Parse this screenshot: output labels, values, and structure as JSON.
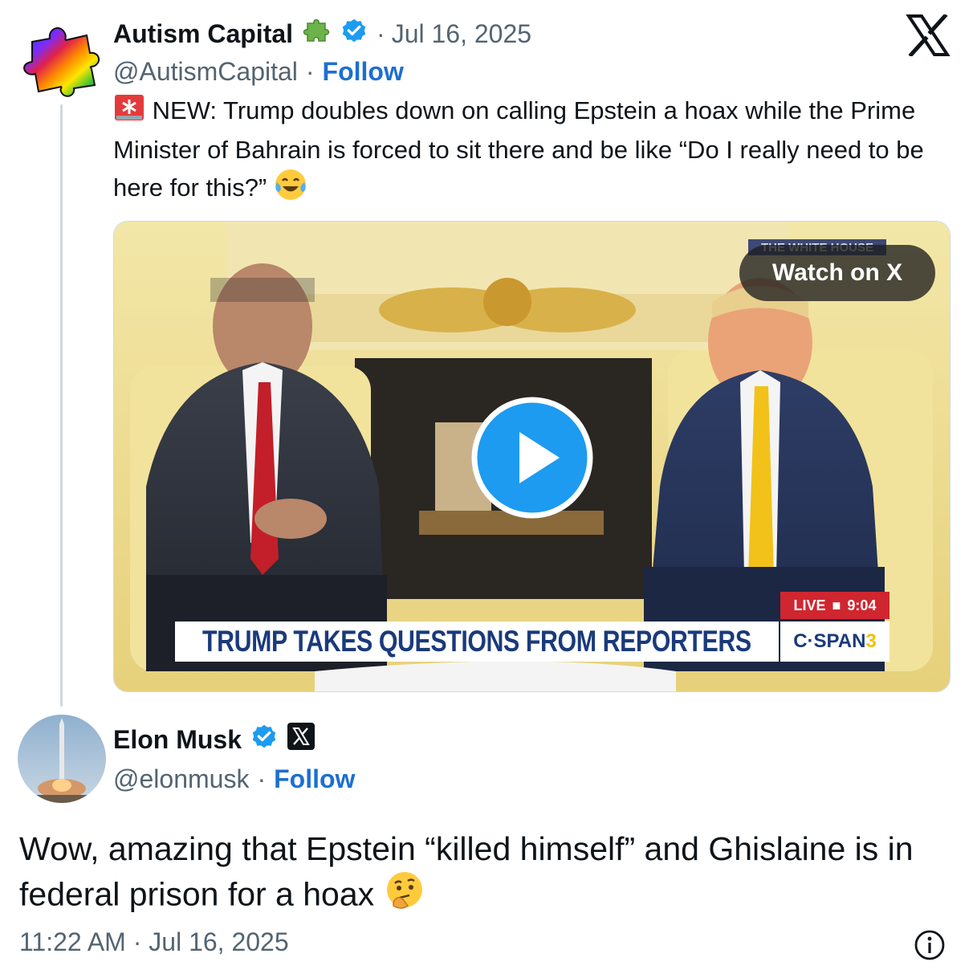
{
  "quoted_post": {
    "author_name": "Autism Capital",
    "handle": "@AutismCapital",
    "separator": "·",
    "date": "Jul 16, 2025",
    "follow_label": "Follow",
    "text": "NEW: Trump doubles down on calling Epstein a hoax while the Prime Minister of Bahrain is forced to sit there and be like “Do I really need to be here for this?”",
    "media": {
      "watch_label": "Watch on X",
      "chyron": "TRUMP TAKES QUESTIONS FROM REPORTERS",
      "network": "C·SPAN",
      "network_num": "3",
      "live_label": "LIVE",
      "live_time": "9:04",
      "bug_text": "THE WHITE HOUSE"
    }
  },
  "reply_post": {
    "author_name": "Elon Musk",
    "handle": "@elonmusk",
    "separator": "·",
    "follow_label": "Follow",
    "text": "Wow, amazing that Epstein “killed himself” and Ghislaine is in federal prison for a hoax",
    "time": "11:22 AM",
    "date": "Jul 16, 2025",
    "footer_separator": "·"
  },
  "icons": {
    "platform": "x-logo-icon",
    "verified": "verified-badge-icon",
    "puzzle": "puzzle-piece-icon",
    "siren": "siren-emoji-icon",
    "laugh": "tears-of-joy-emoji-icon",
    "thinking": "thinking-emoji-icon",
    "play": "play-icon",
    "info": "info-icon"
  },
  "colors": {
    "link": "#1d6fd1",
    "verified": "#1d9bf0",
    "secondary_text": "#536471",
    "puzzle_green": "#6bb34a"
  }
}
